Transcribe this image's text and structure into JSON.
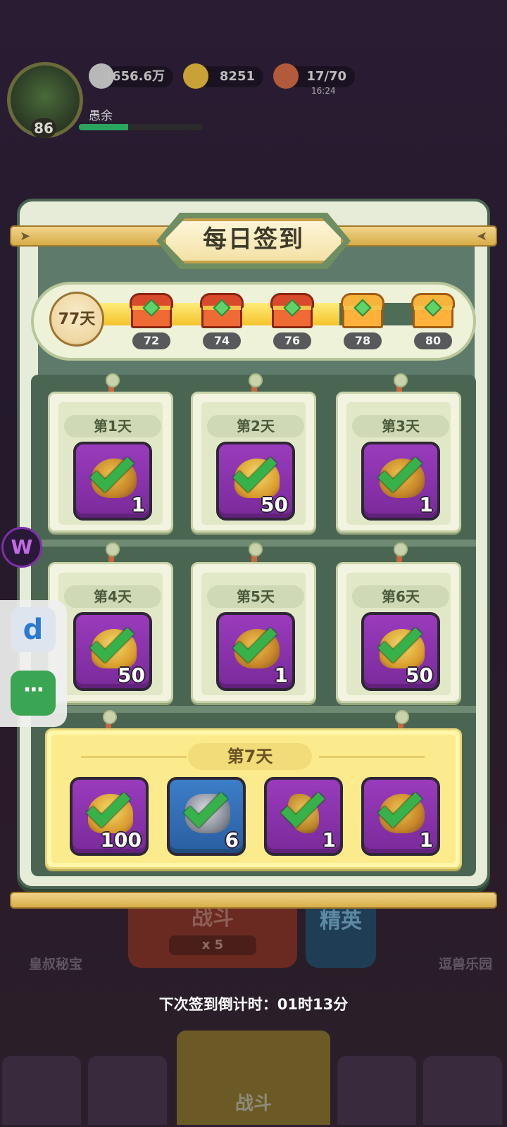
{
  "hud": {
    "level": "86",
    "player_name": "愚余",
    "silver": "4656.6万",
    "gold": "8251",
    "stamina": "17/70",
    "stamina_timer": "16:24"
  },
  "background": {
    "battle_label": "战斗",
    "battle_cost": "x 5",
    "elite_label": "精英",
    "left_feature": "皇叔秘宝",
    "right_feature": "逗兽乐园",
    "nav_center_label": "战斗"
  },
  "dialog": {
    "title": "每日签到",
    "days_signed": "77天",
    "progress": {
      "current": 77,
      "min": 70,
      "max": 80
    },
    "milestones": [
      {
        "label": "72",
        "claimed": true
      },
      {
        "label": "74",
        "claimed": true
      },
      {
        "label": "76",
        "claimed": true
      },
      {
        "label": "78",
        "claimed": false
      },
      {
        "label": "80",
        "claimed": false
      }
    ],
    "days": [
      {
        "label": "第1天",
        "item": "helmet-icon",
        "qty": "1"
      },
      {
        "label": "第2天",
        "item": "heart-icon",
        "qty": "50"
      },
      {
        "label": "第3天",
        "item": "helmet-icon",
        "qty": "1"
      },
      {
        "label": "第4天",
        "item": "heart-icon",
        "qty": "50"
      },
      {
        "label": "第5天",
        "item": "helmet-icon",
        "qty": "1"
      },
      {
        "label": "第6天",
        "item": "heart-icon",
        "qty": "50"
      }
    ],
    "day7": {
      "label": "第7天",
      "items": [
        {
          "item": "heart-icon",
          "qty": "100",
          "color": "purple"
        },
        {
          "item": "ore-icon",
          "qty": "6",
          "color": "blue"
        },
        {
          "item": "key-icon",
          "qty": "1",
          "color": "purple"
        },
        {
          "item": "helmet-icon",
          "qty": "1",
          "color": "purple"
        }
      ]
    }
  },
  "countdown": "下次签到倒计时：01时13分",
  "colors": {
    "panel": "#e6ecd7",
    "panel_border": "#4a6552",
    "progress_fill": "#f4c32b",
    "check": "#37b24a",
    "item_purple": "#8a33ab",
    "item_blue": "#3270b5"
  }
}
